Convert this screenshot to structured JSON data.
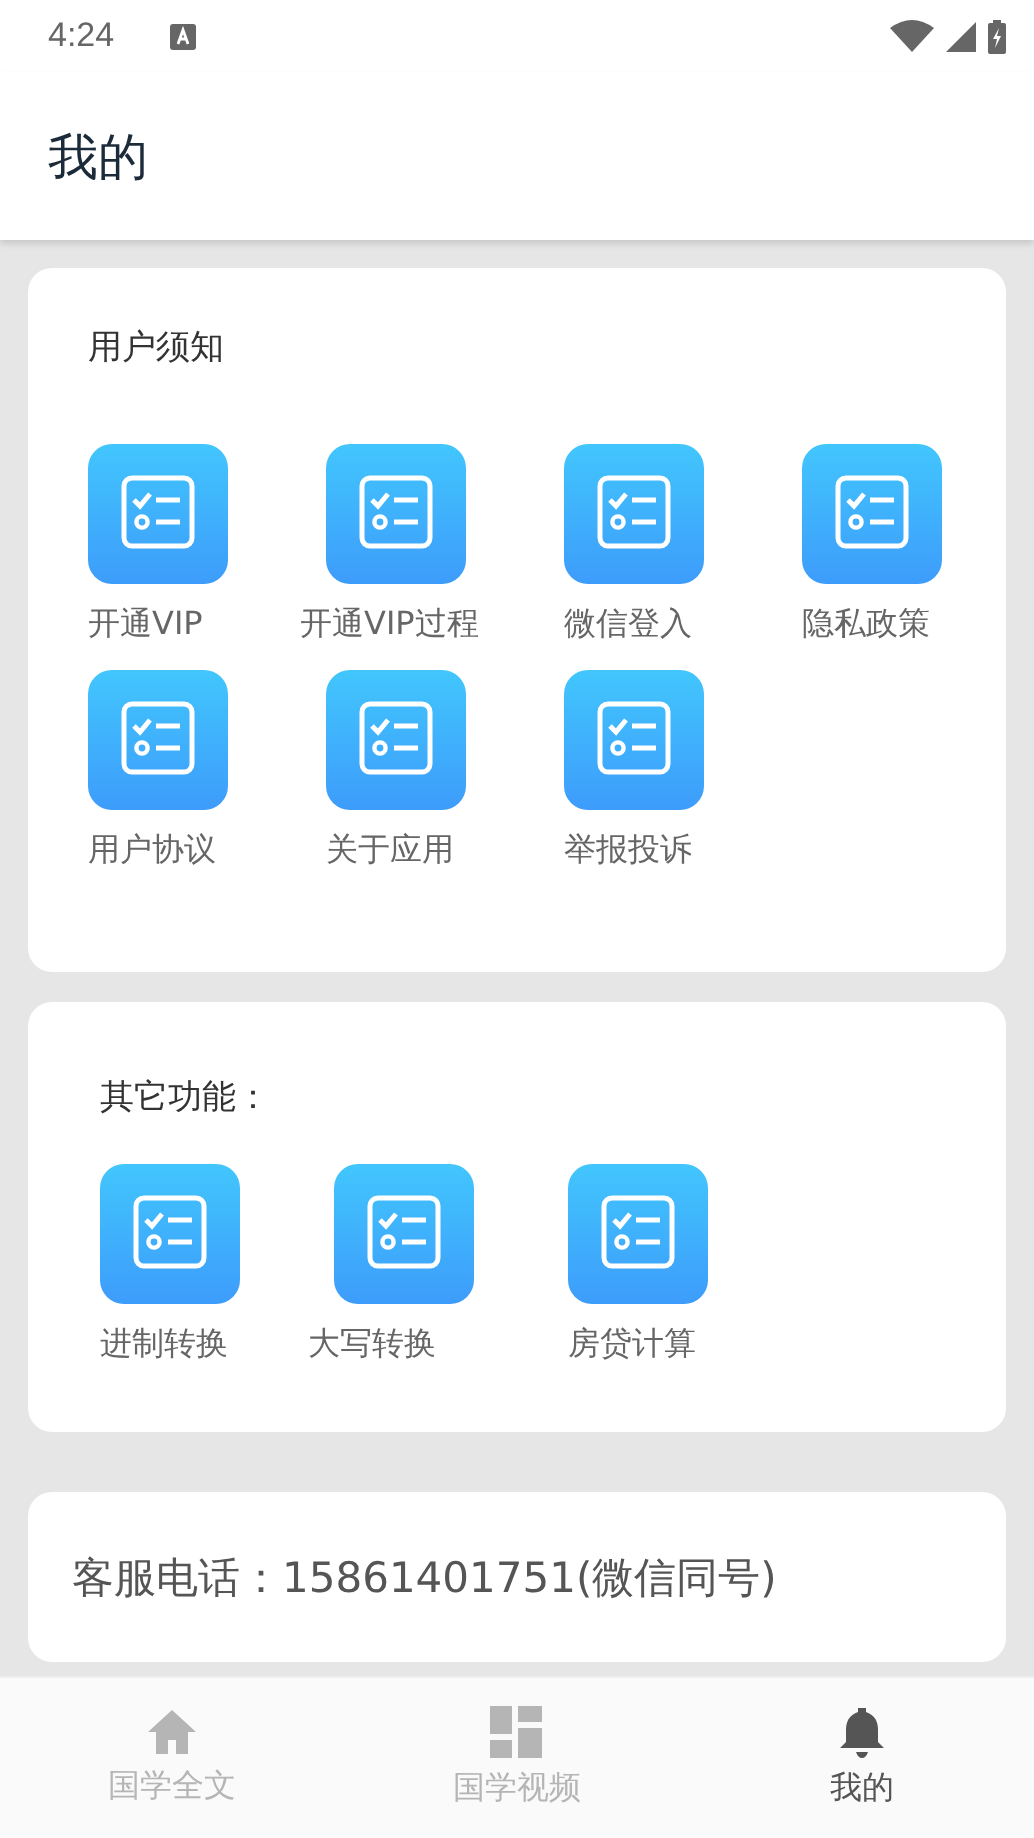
{
  "status_bar": {
    "time": "4:24"
  },
  "header": {
    "title": "我的"
  },
  "sections": [
    {
      "title": "用户须知",
      "items": [
        "开通VIP",
        "开通VIP过程",
        "微信登入",
        "隐私政策",
        "用户协议",
        "关于应用",
        "举报投诉"
      ]
    },
    {
      "title": "其它功能：",
      "items": [
        "进制转换",
        "大写转换",
        "房贷计算"
      ]
    }
  ],
  "contact": {
    "text": "客服电话：15861401751(微信同号)"
  },
  "tabs": [
    {
      "label": "国学全文",
      "kind": "home",
      "selected": false
    },
    {
      "label": "国学视频",
      "kind": "grid",
      "selected": false
    },
    {
      "label": "我的",
      "kind": "bell",
      "selected": true
    }
  ]
}
